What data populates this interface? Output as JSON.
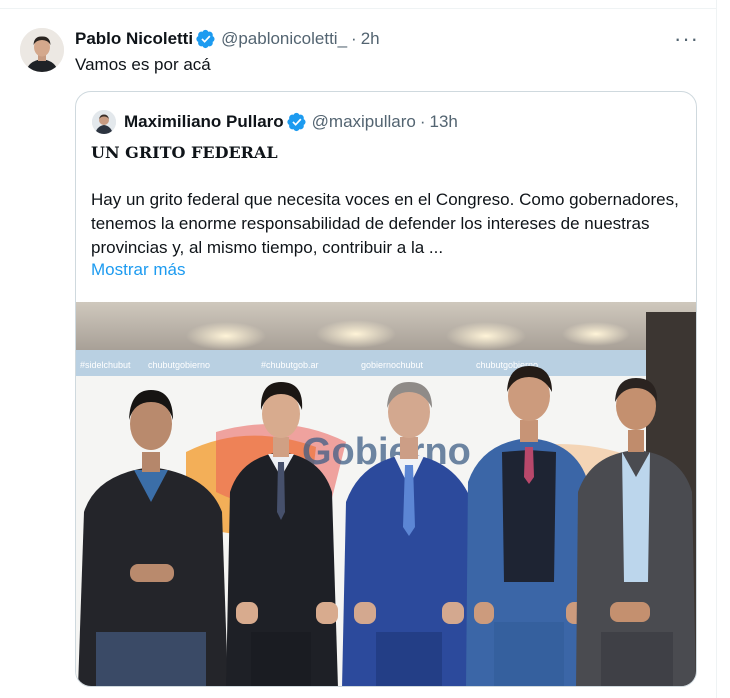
{
  "tweet": {
    "author_name": "Pablo Nicoletti",
    "handle": "@pablonicoletti_",
    "separator": "·",
    "time": "2h",
    "more_icon": "···",
    "text": "Vamos es por acá"
  },
  "quote": {
    "author_name": "Maximiliano Pullaro",
    "handle": "@maxipullaro",
    "separator": "·",
    "time": "13h",
    "headline": "UN GRITO FEDERAL",
    "body": "Hay un grito federal que necesita voces en el Congreso. Como gobernadores, tenemos la enorme responsabilidad de defender los intereses de nuestras provincias y, al mismo tiempo, contribuir a la ...",
    "show_more": "Mostrar más"
  },
  "photo": {
    "banner_logo_text": "Gobierno",
    "banner_tags": [
      "#sidelchubut",
      "chubutgobierno",
      "#chubutgob.ar",
      "gobiernochubut",
      "chubutgobierno"
    ]
  },
  "colors": {
    "accent": "#1d9bf0",
    "verified": "#1d9bf0",
    "text": "#0f1419",
    "muted": "#536471",
    "border": "#cfd9de"
  }
}
